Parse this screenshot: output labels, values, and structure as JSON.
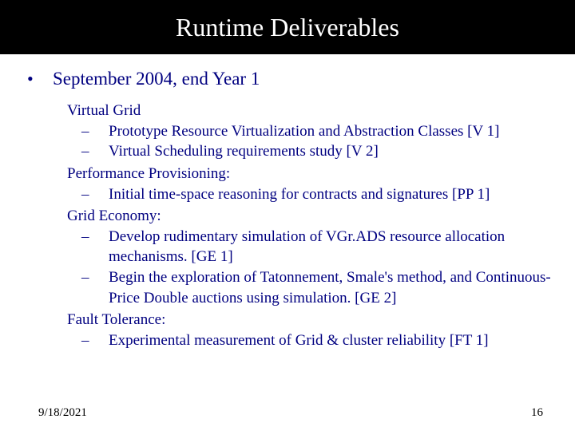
{
  "title": "Runtime Deliverables",
  "bullet": "September 2004, end Year 1",
  "sections": {
    "vg": {
      "head": "Virtual Grid",
      "items": [
        "Prototype Resource Virtualization and Abstraction Classes [V 1]",
        "Virtual Scheduling requirements study [V 2]"
      ]
    },
    "pp": {
      "head": "Performance Provisioning:",
      "items": [
        "Initial  time-space reasoning for contracts and signatures [PP 1]"
      ]
    },
    "ge": {
      "head": "Grid Economy:",
      "items": [
        "Develop rudimentary simulation of VGr.ADS resource allocation mechanisms. [GE 1]",
        "Begin the exploration of Tatonnement, Smale's method, and Continuous-Price Double auctions using simulation. [GE 2]"
      ]
    },
    "ft": {
      "head": "Fault Tolerance:",
      "items": [
        "Experimental measurement of Grid & cluster reliability [FT 1]"
      ]
    }
  },
  "footer": {
    "date": "9/18/2021",
    "page": "16"
  }
}
